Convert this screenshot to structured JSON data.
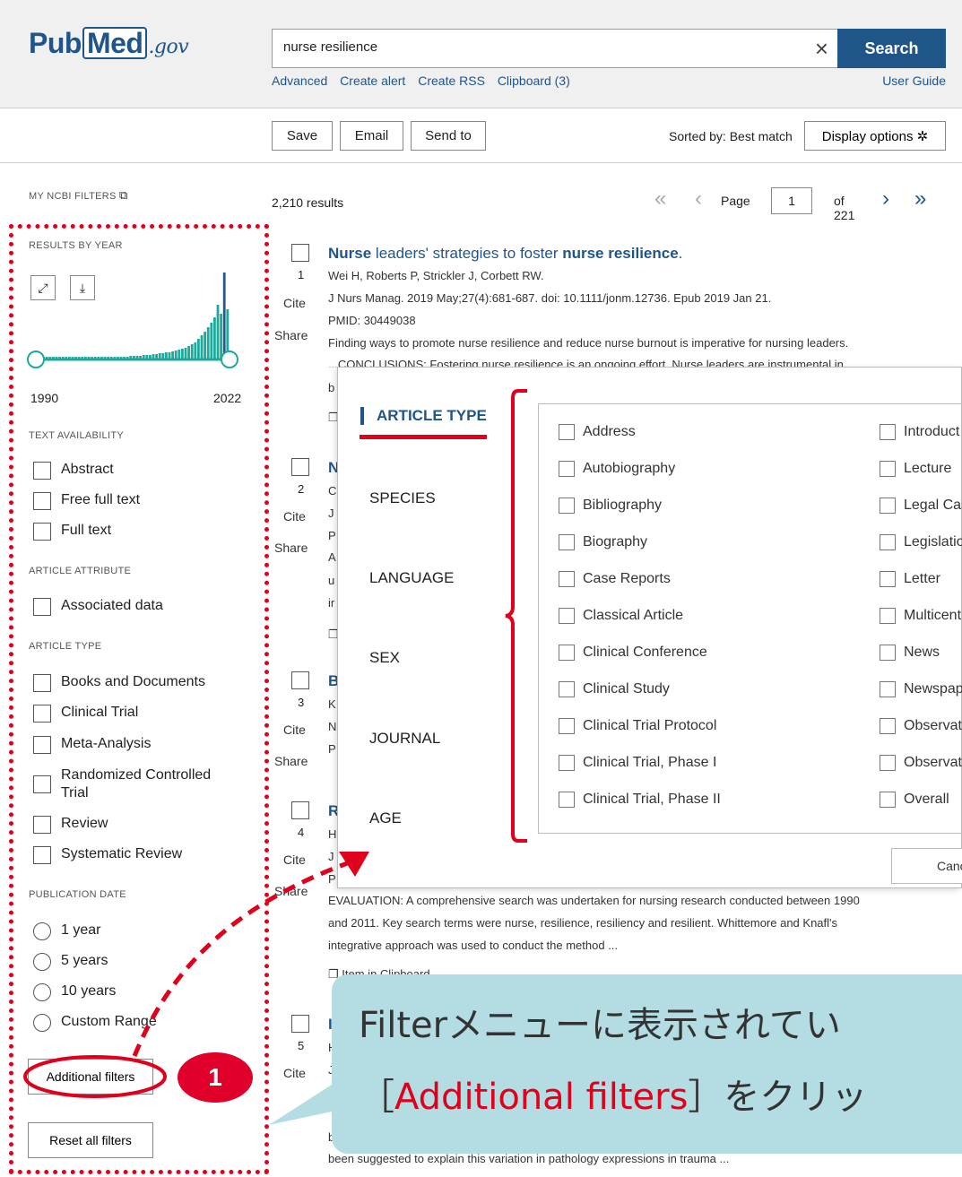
{
  "header": {
    "logo_pub": "Pub",
    "logo_med": "Med",
    "logo_gov": ".gov",
    "search_value": "nurse resilience",
    "clear_glyph": "×",
    "search_button": "Search",
    "links": [
      "Advanced",
      "Create alert",
      "Create RSS",
      "Clipboard (3)"
    ],
    "user_guide": "User Guide"
  },
  "toolbar": {
    "save": "Save",
    "email": "Email",
    "send_to": "Send to",
    "sorted_by": "Sorted by: Best match",
    "display_options": "Display options",
    "display_options_icon": "gear-icon"
  },
  "sidebar": {
    "my_ncbi_filters": "MY NCBI FILTERS",
    "results_by_year": "RESULTS BY YEAR",
    "year_start": "1990",
    "year_end": "2022",
    "histogram": [
      1,
      1,
      1,
      1,
      1,
      1,
      1,
      1,
      1,
      1,
      1,
      1,
      1,
      1,
      1,
      1,
      1,
      1,
      1,
      1,
      1,
      1,
      1,
      2,
      2,
      2,
      2,
      2,
      2,
      3,
      3,
      3,
      3,
      4,
      4,
      4,
      5,
      5,
      6,
      6,
      7,
      7,
      8,
      9,
      10,
      11,
      12,
      14,
      16,
      18,
      22,
      26,
      30,
      35,
      40,
      46,
      60,
      50,
      96,
      55
    ],
    "text_availability": "TEXT AVAILABILITY",
    "text_options": [
      "Abstract",
      "Free full text",
      "Full text"
    ],
    "article_attribute": "ARTICLE ATTRIBUTE",
    "attribute_options": [
      "Associated data"
    ],
    "article_type": "ARTICLE TYPE",
    "type_options": [
      "Books and Documents",
      "Clinical Trial",
      "Meta-Analysis",
      "Randomized Controlled Trial",
      "Review",
      "Systematic Review"
    ],
    "publication_date": "PUBLICATION DATE",
    "date_options": [
      "1 year",
      "5 years",
      "10 years",
      "Custom Range"
    ],
    "additional_filters": "Additional filters",
    "reset_all": "Reset all filters"
  },
  "results": {
    "count": "2,210 results",
    "page_label": "Page",
    "page_value": "1",
    "page_of": "of 221",
    "cite": "Cite",
    "share": "Share",
    "items": [
      {
        "num": "1",
        "title_a": "Nurse",
        "title_b": " leaders' strategies to foster ",
        "title_c": "nurse resilience",
        "title_d": ".",
        "authors": "Wei H, Roberts P, Strickler J, Corbett RW.",
        "journal": "J Nurs Manag. 2019 May;27(4):681-687. doi: 10.1111/jonm.12736. Epub 2019 Jan 21.",
        "pmid": "PMID: 30449038",
        "snippet": "Finding ways to promote nurse resilience and reduce nurse burnout is imperative for nursing leaders.",
        "snippet2": "...CONCLUSIONS: Fostering nurse resilience is an ongoing effort. Nurse leaders are instrumental in"
      },
      {
        "num": "2",
        "title_a": "N"
      },
      {
        "num": "3",
        "title_a": "B"
      },
      {
        "num": "4",
        "title_a": "R",
        "snippet": "EVALUATION: A comprehensive search was undertaken for nursing research conducted between 1990",
        "snippet2": "and 2011. Key search terms were nurse, resilience, resiliency and resilient. Whittemore and Knafl's",
        "snippet3": "integrative approach was used to conduct the method ...",
        "clipboard": "Item in Clipboard"
      },
      {
        "num": "5",
        "title_a": "I",
        "snippet": "been suggested to explain this variation in pathology expressions in trauma ..."
      }
    ]
  },
  "modal": {
    "tabs": [
      "ARTICLE TYPE",
      "SPECIES",
      "LANGUAGE",
      "SEX",
      "JOURNAL",
      "AGE"
    ],
    "left_options": [
      "Address",
      "Autobiography",
      "Bibliography",
      "Biography",
      "Case Reports",
      "Classical Article",
      "Clinical Conference",
      "Clinical Study",
      "Clinical Trial Protocol",
      "Clinical Trial, Phase I",
      "Clinical Trial, Phase II"
    ],
    "right_options": [
      "Introduct",
      "Lecture",
      "Legal Cas",
      "Legislatio",
      "Letter",
      "Multicent",
      "News",
      "Newspap",
      "Observat",
      "Observat",
      "Overall"
    ],
    "cancel": "Cano"
  },
  "annotation": {
    "line1": "Filterメニューに表示されてい",
    "line2_open": "［",
    "line2_red": "Additional filters",
    "line2_close": "］をクリッ",
    "step": "1",
    "highlight_color": "#e0001b"
  }
}
